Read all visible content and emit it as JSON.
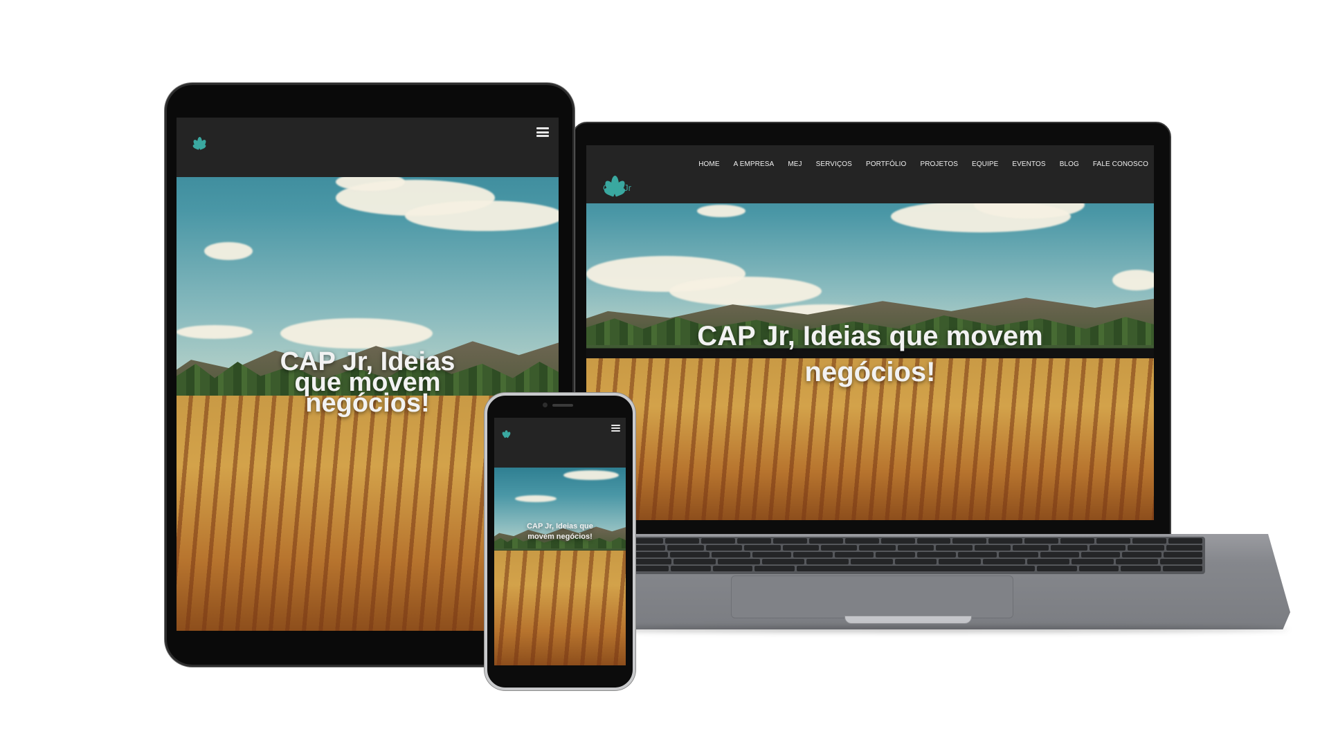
{
  "brand": {
    "logo_text": "CAP Jr",
    "accent_color": "#3aa8a0",
    "navbar_color": "#242424"
  },
  "hero": {
    "headline": "CAP Jr, Ideias que movem negócios!"
  },
  "laptop": {
    "nav": [
      "HOME",
      "A EMPRESA",
      "MEJ",
      "SERVIÇOS",
      "PORTFÓLIO",
      "PROJETOS",
      "EQUIPE",
      "EVENTOS",
      "BLOG",
      "FALE CONOSCO"
    ]
  },
  "tablet": {
    "menu_icon": "hamburger-menu-icon"
  },
  "phone": {
    "menu_icon": "hamburger-menu-icon"
  },
  "icons": {
    "logo": "lotus-leaf-logo"
  }
}
